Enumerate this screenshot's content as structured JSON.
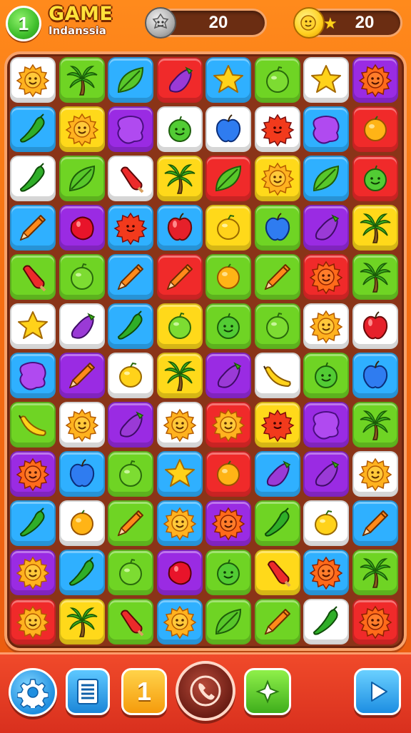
{
  "header": {
    "level_badge": "1",
    "title": "GAME",
    "subtitle": "Indanssia",
    "counters": [
      {
        "icon": "silver-coin-face-icon",
        "value": "20"
      },
      {
        "icon": "gold-coin-star-icon",
        "value": "20"
      }
    ]
  },
  "colors": {
    "W": "#ffffff",
    "B": "#2fb0ff",
    "G": "#6fd424",
    "R": "#f02a2a",
    "P": "#9a2be3",
    "Y": "#ffd91a"
  },
  "board": {
    "cols": 8,
    "rows": [
      [
        [
          "W",
          "sun"
        ],
        [
          "G",
          "palm"
        ],
        [
          "B",
          "leaf"
        ],
        [
          "R",
          "eggplant"
        ],
        [
          "B",
          "star"
        ],
        [
          "G",
          "lime"
        ],
        [
          "W",
          "star"
        ],
        [
          "P",
          "orange-sun"
        ]
      ],
      [
        [
          "B",
          "chili"
        ],
        [
          "Y",
          "sun"
        ],
        [
          "P",
          "blob"
        ],
        [
          "W",
          "green-smile"
        ],
        [
          "W",
          "blue-apple"
        ],
        [
          "W",
          "red-sun"
        ],
        [
          "B",
          "blob"
        ],
        [
          "R",
          "orange"
        ]
      ],
      [
        [
          "W",
          "chili"
        ],
        [
          "G",
          "leaf"
        ],
        [
          "W",
          "popsicle"
        ],
        [
          "Y",
          "palm"
        ],
        [
          "R",
          "leaf"
        ],
        [
          "Y",
          "sun"
        ],
        [
          "B",
          "leaf"
        ],
        [
          "R",
          "green-smile"
        ]
      ],
      [
        [
          "B",
          "pencil"
        ],
        [
          "P",
          "berry"
        ],
        [
          "B",
          "red-sun"
        ],
        [
          "B",
          "apple"
        ],
        [
          "Y",
          "lemon"
        ],
        [
          "G",
          "blue-apple"
        ],
        [
          "P",
          "eggplant"
        ],
        [
          "Y",
          "palm"
        ]
      ],
      [
        [
          "G",
          "popsicle"
        ],
        [
          "G",
          "lime"
        ],
        [
          "B",
          "pencil"
        ],
        [
          "R",
          "pencil"
        ],
        [
          "G",
          "orange"
        ],
        [
          "G",
          "pencil"
        ],
        [
          "R",
          "orange-sun"
        ],
        [
          "G",
          "palm"
        ]
      ],
      [
        [
          "W",
          "star"
        ],
        [
          "W",
          "eggplant"
        ],
        [
          "B",
          "chili"
        ],
        [
          "Y",
          "lime"
        ],
        [
          "G",
          "green-smile"
        ],
        [
          "G",
          "lime"
        ],
        [
          "W",
          "sun"
        ],
        [
          "W",
          "apple"
        ]
      ],
      [
        [
          "B",
          "blob"
        ],
        [
          "P",
          "pencil"
        ],
        [
          "W",
          "lemon"
        ],
        [
          "Y",
          "palm"
        ],
        [
          "P",
          "eggplant"
        ],
        [
          "W",
          "banana"
        ],
        [
          "G",
          "green-smile"
        ],
        [
          "B",
          "blue-apple"
        ]
      ],
      [
        [
          "G",
          "banana"
        ],
        [
          "W",
          "sun"
        ],
        [
          "P",
          "eggplant"
        ],
        [
          "W",
          "sun"
        ],
        [
          "R",
          "sun"
        ],
        [
          "Y",
          "red-sun"
        ],
        [
          "P",
          "blob"
        ],
        [
          "G",
          "palm"
        ]
      ],
      [
        [
          "P",
          "orange-sun"
        ],
        [
          "B",
          "blue-apple"
        ],
        [
          "G",
          "lime"
        ],
        [
          "B",
          "star"
        ],
        [
          "R",
          "orange"
        ],
        [
          "B",
          "eggplant"
        ],
        [
          "P",
          "eggplant"
        ],
        [
          "W",
          "sun"
        ]
      ],
      [
        [
          "B",
          "chili"
        ],
        [
          "W",
          "orange"
        ],
        [
          "G",
          "pencil"
        ],
        [
          "B",
          "sun"
        ],
        [
          "P",
          "orange-sun"
        ],
        [
          "G",
          "chili"
        ],
        [
          "W",
          "lemon"
        ],
        [
          "B",
          "pencil"
        ]
      ],
      [
        [
          "P",
          "sun"
        ],
        [
          "B",
          "chili"
        ],
        [
          "G",
          "lime"
        ],
        [
          "P",
          "berry"
        ],
        [
          "G",
          "green-smile"
        ],
        [
          "Y",
          "popsicle"
        ],
        [
          "B",
          "orange-sun"
        ],
        [
          "G",
          "palm"
        ]
      ],
      [
        [
          "R",
          "sun"
        ],
        [
          "Y",
          "palm"
        ],
        [
          "G",
          "popsicle"
        ],
        [
          "B",
          "sun"
        ],
        [
          "G",
          "leaf"
        ],
        [
          "G",
          "pencil"
        ],
        [
          "W",
          "chili"
        ],
        [
          "R",
          "orange-sun"
        ]
      ]
    ]
  },
  "footer": {
    "level_button": "1",
    "buttons": [
      "settings-button",
      "menu-button",
      "level-button",
      "call-button",
      "booster-button",
      "play-button"
    ]
  }
}
